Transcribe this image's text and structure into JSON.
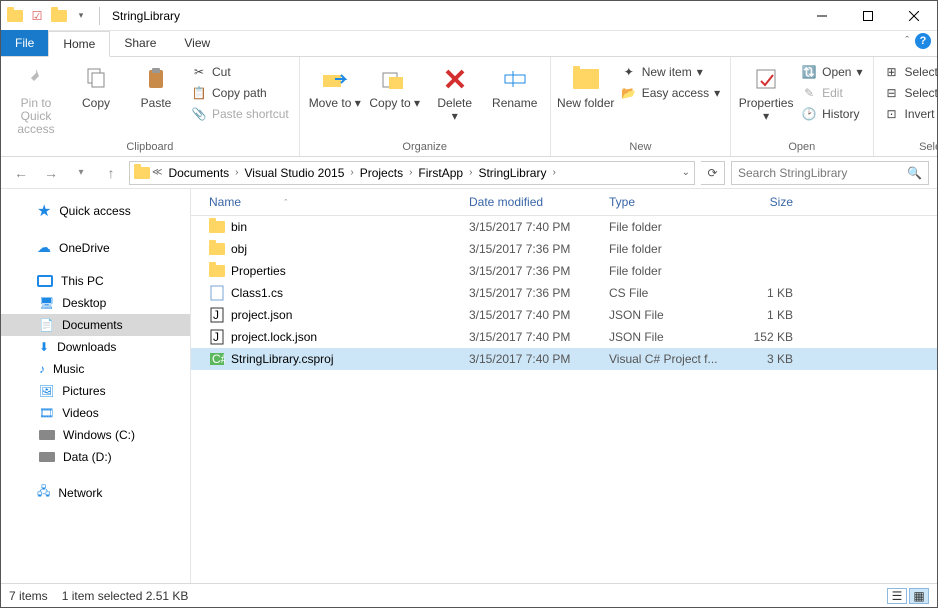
{
  "window": {
    "title": "StringLibrary"
  },
  "tabs": {
    "file": "File",
    "home": "Home",
    "share": "Share",
    "view": "View"
  },
  "ribbon": {
    "clipboard": {
      "label": "Clipboard",
      "pin": "Pin to Quick access",
      "copy": "Copy",
      "paste": "Paste",
      "cut": "Cut",
      "copy_path": "Copy path",
      "paste_shortcut": "Paste shortcut"
    },
    "organize": {
      "label": "Organize",
      "move_to": "Move to",
      "copy_to": "Copy to",
      "delete": "Delete",
      "rename": "Rename"
    },
    "new": {
      "label": "New",
      "new_folder": "New folder",
      "new_item": "New item",
      "easy_access": "Easy access"
    },
    "open": {
      "label": "Open",
      "properties": "Properties",
      "open": "Open",
      "edit": "Edit",
      "history": "History"
    },
    "select": {
      "label": "Select",
      "select_all": "Select all",
      "select_none": "Select none",
      "invert": "Invert selection"
    }
  },
  "breadcrumb": [
    "Documents",
    "Visual Studio 2015",
    "Projects",
    "FirstApp",
    "StringLibrary"
  ],
  "search_placeholder": "Search StringLibrary",
  "nav": {
    "quick_access": "Quick access",
    "onedrive": "OneDrive",
    "this_pc": "This PC",
    "desktop": "Desktop",
    "documents": "Documents",
    "downloads": "Downloads",
    "music": "Music",
    "pictures": "Pictures",
    "videos": "Videos",
    "drive_c": "Windows (C:)",
    "drive_d": "Data (D:)",
    "network": "Network"
  },
  "columns": {
    "name": "Name",
    "date": "Date modified",
    "type": "Type",
    "size": "Size"
  },
  "files": [
    {
      "name": "bin",
      "date": "3/15/2017 7:40 PM",
      "type": "File folder",
      "size": "",
      "icon": "folder"
    },
    {
      "name": "obj",
      "date": "3/15/2017 7:36 PM",
      "type": "File folder",
      "size": "",
      "icon": "folder"
    },
    {
      "name": "Properties",
      "date": "3/15/2017 7:36 PM",
      "type": "File folder",
      "size": "",
      "icon": "folder"
    },
    {
      "name": "Class1.cs",
      "date": "3/15/2017 7:36 PM",
      "type": "CS File",
      "size": "1 KB",
      "icon": "cs"
    },
    {
      "name": "project.json",
      "date": "3/15/2017 7:40 PM",
      "type": "JSON File",
      "size": "1 KB",
      "icon": "json"
    },
    {
      "name": "project.lock.json",
      "date": "3/15/2017 7:40 PM",
      "type": "JSON File",
      "size": "152 KB",
      "icon": "json"
    },
    {
      "name": "StringLibrary.csproj",
      "date": "3/15/2017 7:40 PM",
      "type": "Visual C# Project f...",
      "size": "3 KB",
      "icon": "csproj"
    }
  ],
  "selected_index": 6,
  "status": {
    "count": "7 items",
    "selection": "1 item selected  2.51 KB"
  }
}
